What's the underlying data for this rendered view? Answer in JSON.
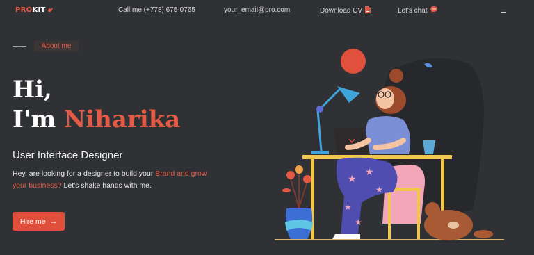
{
  "header": {
    "logo_pro": "PRO",
    "logo_kit": "KIT",
    "nav": {
      "phone": "Call me (+778) 675-0765",
      "email": "your_email@pro.com",
      "cv": "Download CV",
      "chat": "Let's chat"
    }
  },
  "about": {
    "label": "About me"
  },
  "hero": {
    "greeting": "Hi,",
    "intro": "I'm ",
    "name": "Niharika",
    "role": "User Interface Designer",
    "desc_start": "Hey, are looking for a designer to build your ",
    "desc_highlight": "Brand and grow your business?",
    "desc_end": " Let's shake hands with me.",
    "cta": "Hire me",
    "cta_arrow": "→"
  },
  "colors": {
    "background": "#2f3134",
    "accent": "#e45a45",
    "text": "#ffffff"
  },
  "icons": [
    "bird-icon",
    "pdf-icon",
    "chat-icon",
    "hamburger-menu-icon",
    "arrow-right-icon"
  ]
}
